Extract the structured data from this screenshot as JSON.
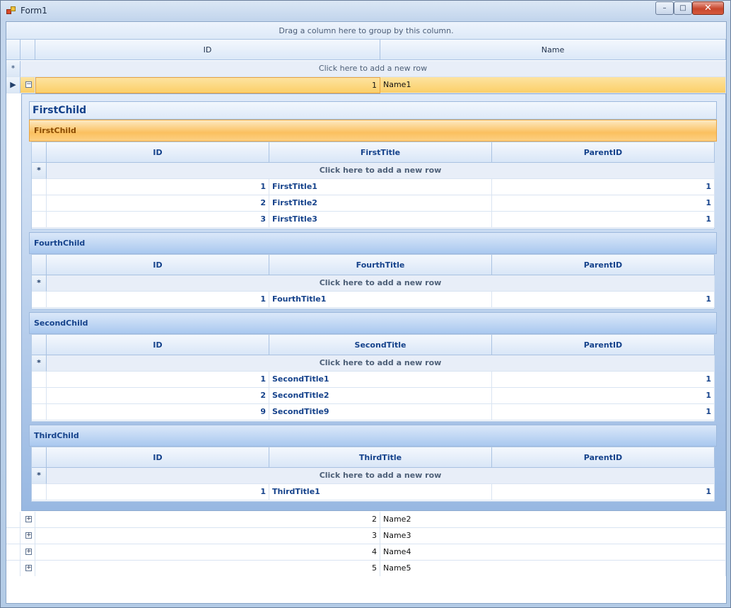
{
  "window": {
    "title": "Form1",
    "minimize_label": "–",
    "maximize_label": "□",
    "close_label": "✕"
  },
  "group_panel": "Drag a column here to group by this column.",
  "master": {
    "columns": [
      "ID",
      "Name"
    ],
    "new_row": "Click here to add a new row",
    "new_row_marker": "*",
    "current_marker": "▶",
    "rows": [
      {
        "id": "1",
        "name": "Name1",
        "expanded": true,
        "expander": "⊟"
      },
      {
        "id": "2",
        "name": "Name2",
        "expander": "⊞"
      },
      {
        "id": "3",
        "name": "Name3",
        "expander": "⊞"
      },
      {
        "id": "4",
        "name": "Name4",
        "expander": "⊞"
      },
      {
        "id": "5",
        "name": "Name5",
        "expander": "⊞"
      }
    ]
  },
  "detail": {
    "title": "FirstChild",
    "bands": [
      {
        "name": "FirstChild",
        "columns": [
          "ID",
          "FirstTitle",
          "ParentID"
        ],
        "new_row": "Click here to add a new row",
        "rows": [
          [
            "1",
            "FirstTitle1",
            "1"
          ],
          [
            "2",
            "FirstTitle2",
            "1"
          ],
          [
            "3",
            "FirstTitle3",
            "1"
          ]
        ]
      },
      {
        "name": "FourthChild",
        "columns": [
          "ID",
          "FourthTitle",
          "ParentID"
        ],
        "new_row": "Click here to add a new row",
        "rows": [
          [
            "1",
            "FourthTitle1",
            "1"
          ]
        ]
      },
      {
        "name": "SecondChild",
        "columns": [
          "ID",
          "SecondTitle",
          "ParentID"
        ],
        "new_row": "Click here to add a new row",
        "rows": [
          [
            "1",
            "SecondTitle1",
            "1"
          ],
          [
            "2",
            "SecondTitle2",
            "1"
          ],
          [
            "9",
            "SecondTitle9",
            "1"
          ]
        ]
      },
      {
        "name": "ThirdChild",
        "columns": [
          "ID",
          "ThirdTitle",
          "ParentID"
        ],
        "new_row": "Click here to add a new row",
        "rows": [
          [
            "1",
            "ThirdTitle1",
            "1"
          ]
        ]
      }
    ]
  }
}
